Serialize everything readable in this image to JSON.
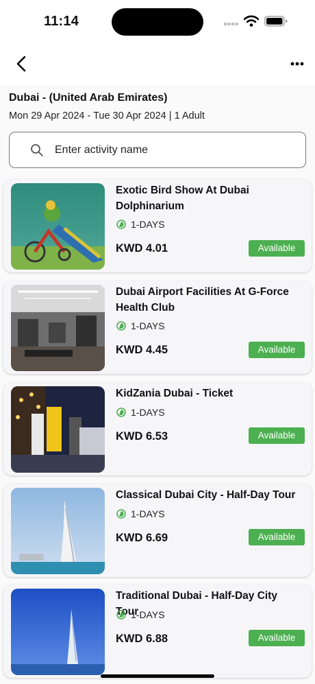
{
  "status_bar": {
    "time": "11:14"
  },
  "header": {
    "destination": "Dubai - (United Arab Emirates)",
    "dates": "Mon 29 Apr 2024 - Tue 30 Apr 2024 | 1 Adult"
  },
  "search": {
    "placeholder": "Enter activity name"
  },
  "colors": {
    "accent_green": "#4caf50",
    "card_bg": "#f6f6f9"
  },
  "activities": [
    {
      "title": "Exotic Bird Show At Dubai Dolphinarium",
      "duration": "1-DAYS",
      "price": "KWD 4.01",
      "status": "Available"
    },
    {
      "title": "Dubai Airport Facilities At G-Force Health Club",
      "duration": "1-DAYS",
      "price": "KWD 4.45",
      "status": "Available"
    },
    {
      "title": "KidZania Dubai - Ticket",
      "duration": "1-DAYS",
      "price": "KWD 6.53",
      "status": "Available"
    },
    {
      "title": "Classical Dubai City - Half-Day Tour",
      "duration": "1-DAYS",
      "price": "KWD 6.69",
      "status": "Available"
    },
    {
      "title": "Traditional Dubai - Half-Day City Tour",
      "duration": "1-DAYS",
      "price": "KWD 6.88",
      "status": "Available"
    }
  ]
}
